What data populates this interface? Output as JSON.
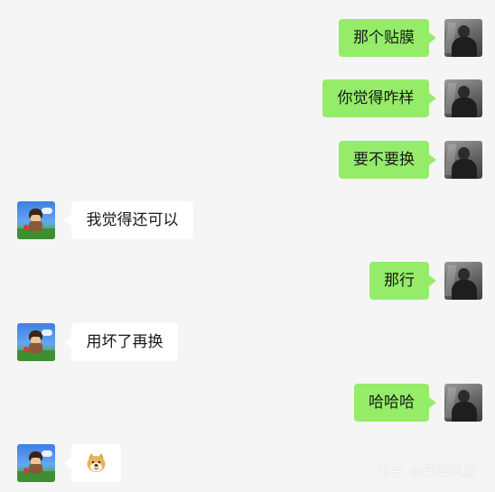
{
  "messages": [
    {
      "side": "out",
      "text": "那个贴膜",
      "avatar_icon": "me-avatar-icon"
    },
    {
      "side": "out",
      "text": "你觉得咋样",
      "avatar_icon": "me-avatar-icon"
    },
    {
      "side": "out",
      "text": "要不要换",
      "avatar_icon": "me-avatar-icon"
    },
    {
      "side": "in",
      "text": "我觉得还可以",
      "avatar_icon": "friend-avatar-icon"
    },
    {
      "side": "out",
      "text": "那行",
      "avatar_icon": "me-avatar-icon"
    },
    {
      "side": "in",
      "text": "用坏了再换",
      "avatar_icon": "friend-avatar-icon"
    },
    {
      "side": "out",
      "text": "哈哈哈",
      "avatar_icon": "me-avatar-icon"
    },
    {
      "side": "in",
      "text": "",
      "sticker": "doge-emoji-icon",
      "avatar_icon": "friend-avatar-icon"
    }
  ],
  "watermark": {
    "text": "知乎 @回望风逝"
  },
  "colors": {
    "background": "#f5f5f5",
    "outgoing_bubble": "#95ec69",
    "incoming_bubble": "#ffffff",
    "text": "#191919"
  }
}
